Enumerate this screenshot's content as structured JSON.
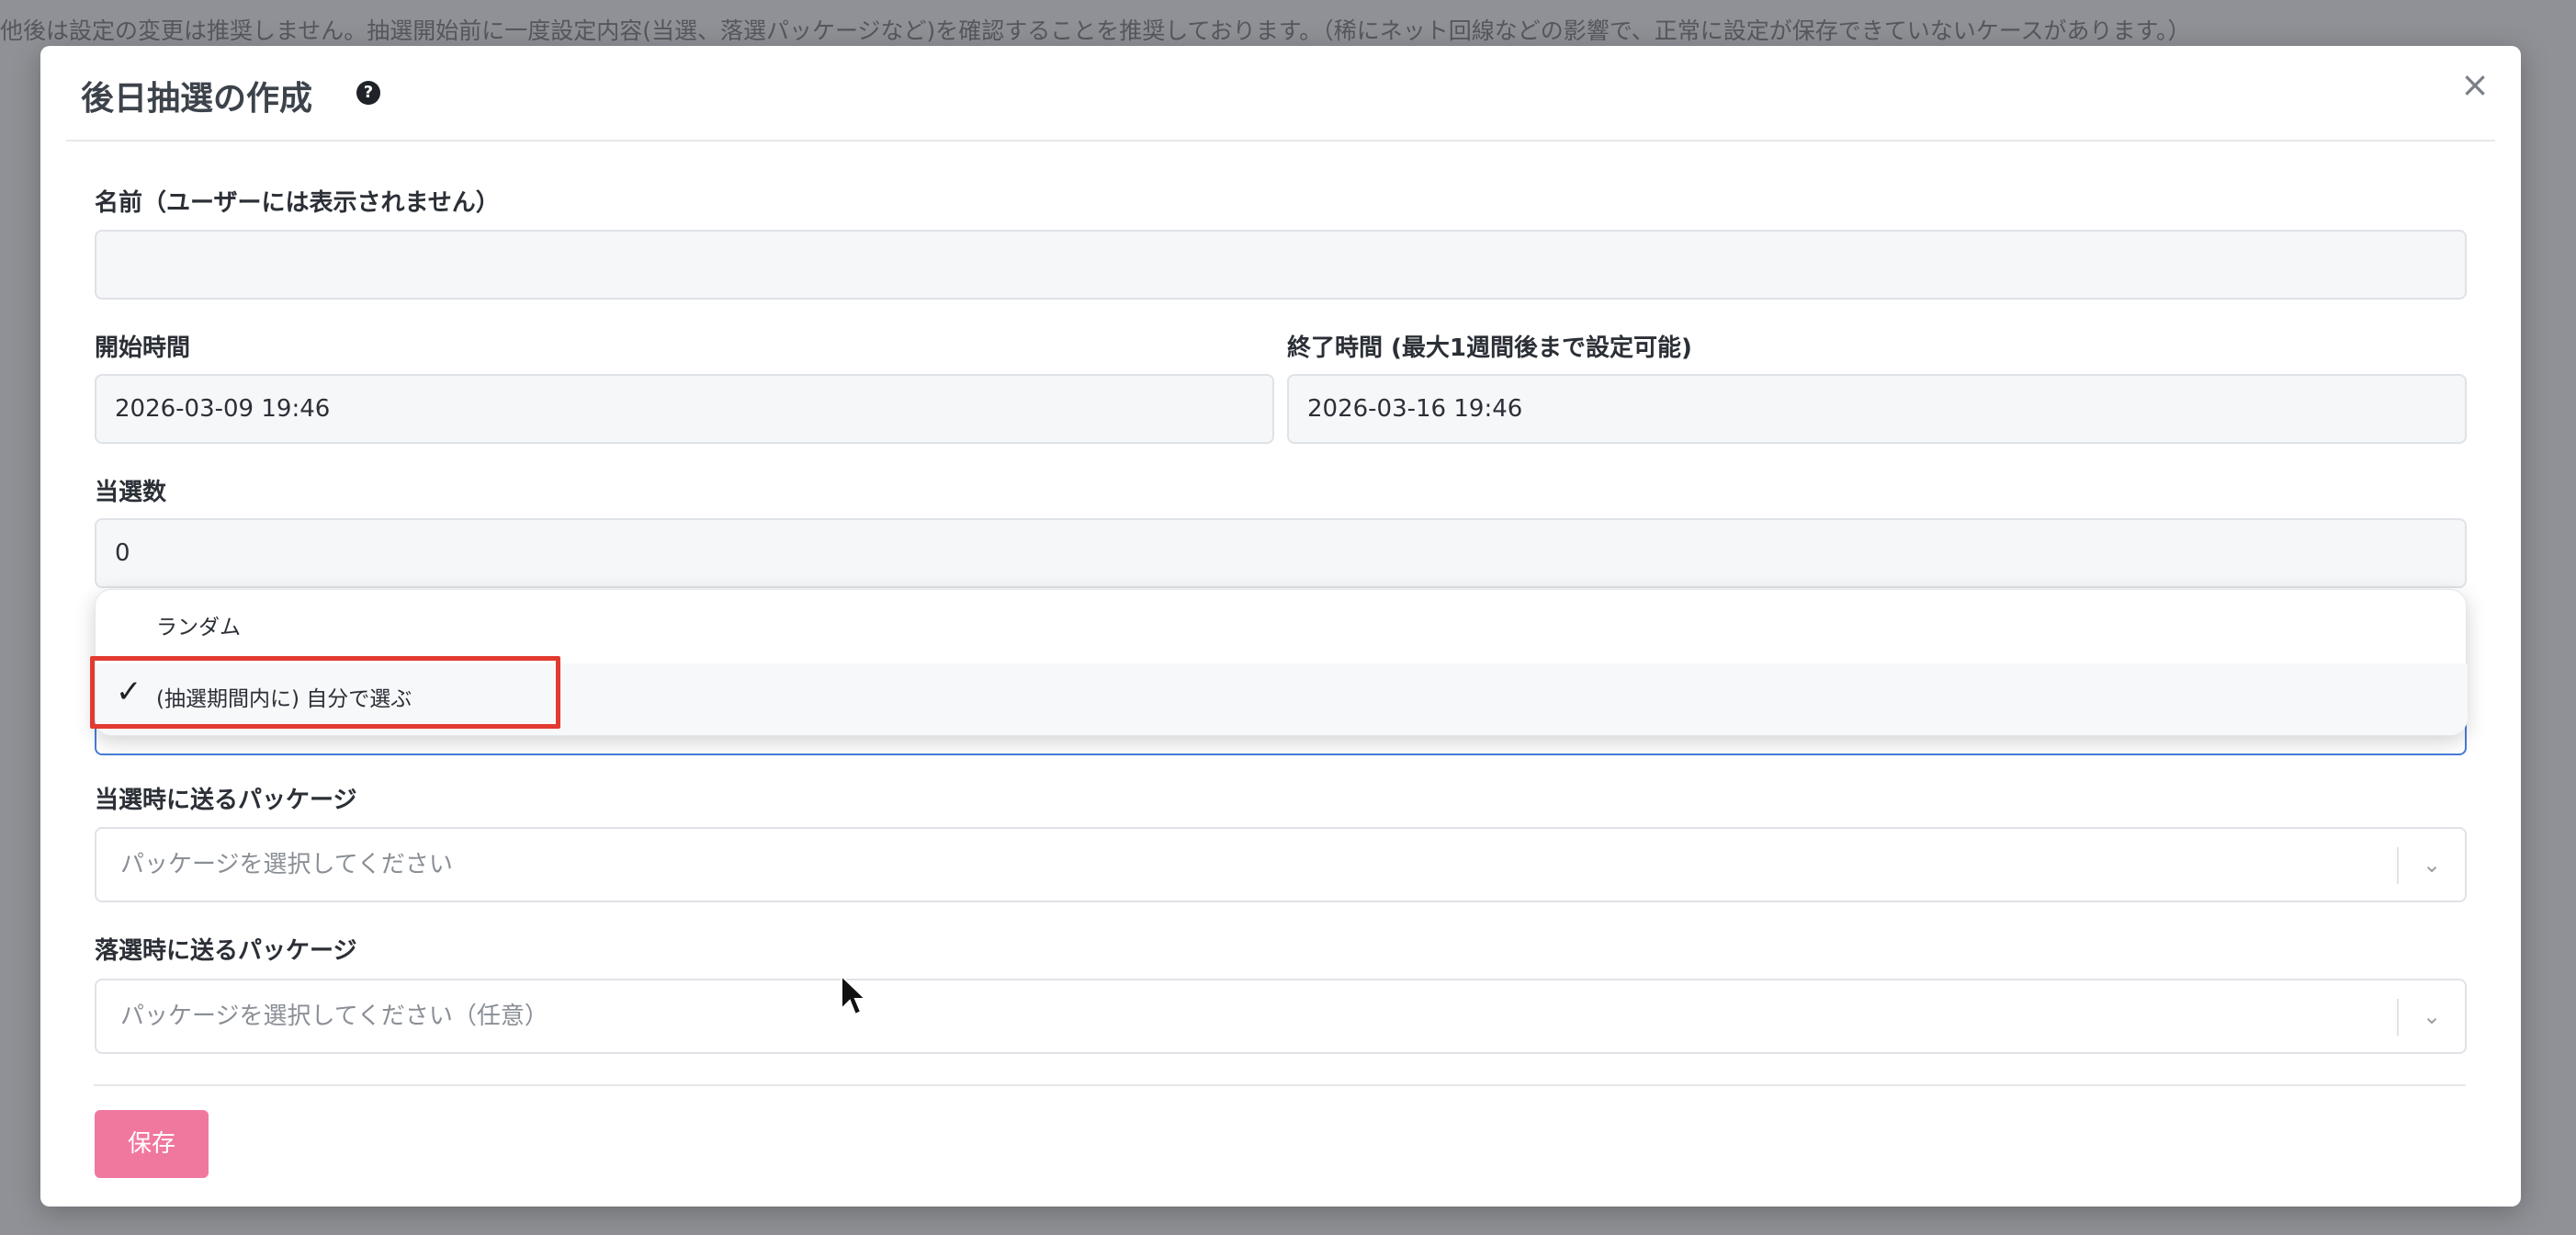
{
  "backdrop": {
    "notice": "他後は設定の変更は推奨しません。抽選開始前に一度設定内容(当選、落選パッケージなど)を確認することを推奨しております。（稀にネット回線などの影響で、正常に設定が保存できていないケースがあります。）"
  },
  "modal": {
    "title": "後日抽選の作成",
    "help_icon": "question-circle-icon",
    "close_icon": "close-icon",
    "close_glyph": "×",
    "help_glyph": "?"
  },
  "form": {
    "name": {
      "label": "名前（ユーザーには表示されません）",
      "value": ""
    },
    "start_time": {
      "label": "開始時間",
      "value": "2026-03-09 19:46"
    },
    "end_time": {
      "label": "終了時間 (最大1週間後まで設定可能)",
      "value": "2026-03-16 19:46"
    },
    "winner_count": {
      "label": "当選数",
      "value": "0"
    },
    "method_dropdown": {
      "options": [
        {
          "label": "ランダム",
          "selected": false
        },
        {
          "label": "(抽選期間内に) 自分で選ぶ",
          "selected": true
        }
      ],
      "check_icon": "check-icon",
      "check_glyph": "✓"
    },
    "win_package": {
      "label": "当選時に送るパッケージ",
      "placeholder": "パッケージを選択してください"
    },
    "lose_package": {
      "label": "落選時に送るパッケージ",
      "placeholder": "パッケージを選択してください（任意）"
    },
    "chevron_glyph": "⌄",
    "save_label": "保存"
  },
  "colors": {
    "accent_button": "#f0789f",
    "focus_border": "#4a7bd9",
    "highlight": "#e23a2f"
  }
}
